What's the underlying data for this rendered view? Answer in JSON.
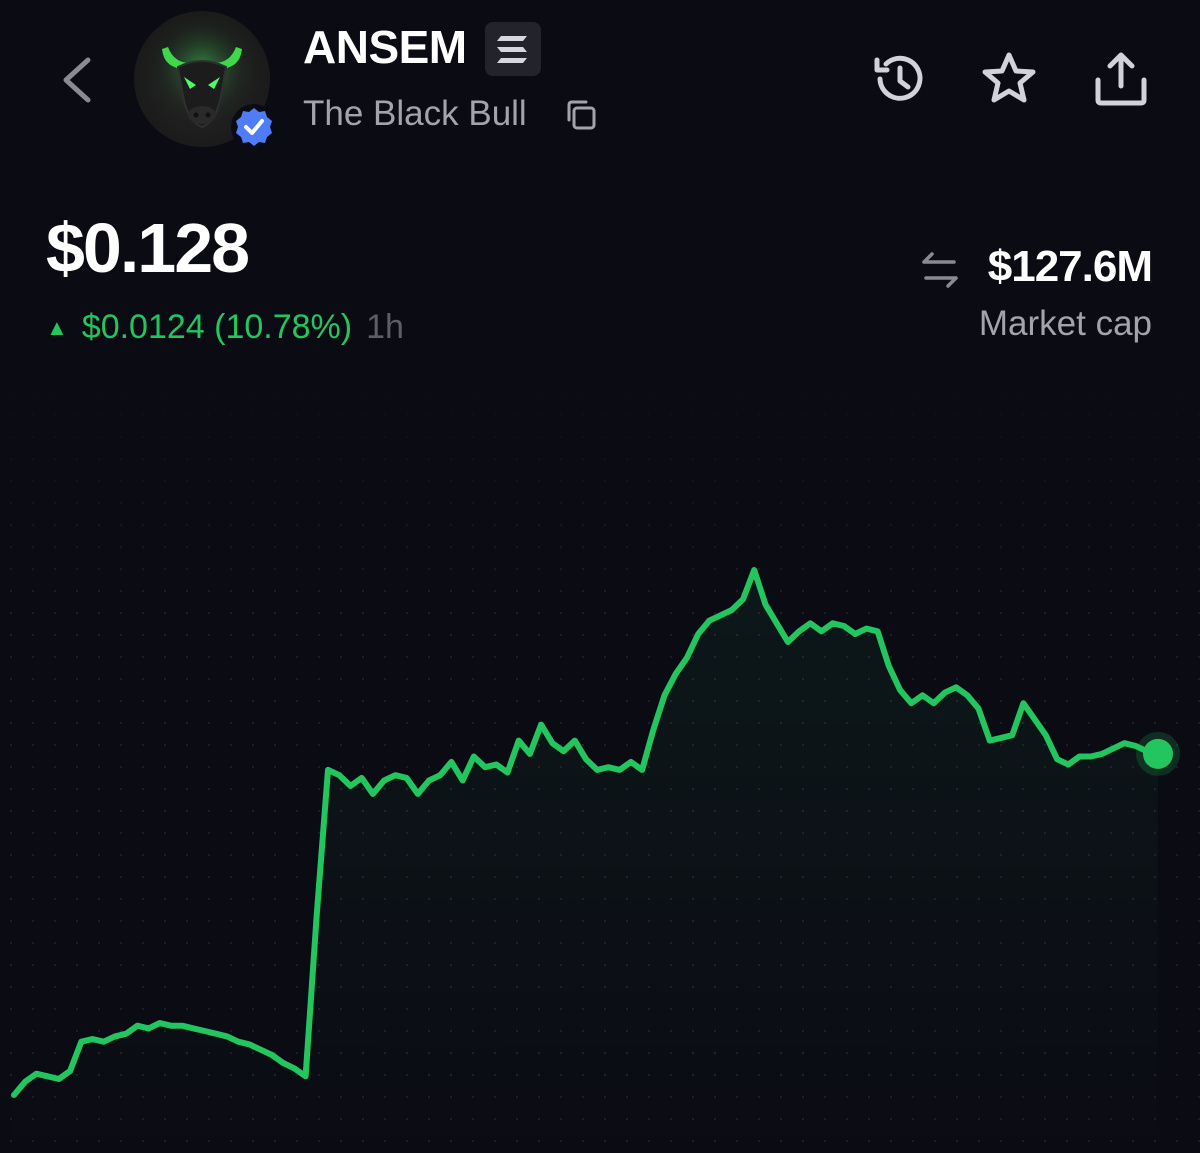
{
  "header": {
    "token_symbol": "ANSEM",
    "token_name": "The Black Bull",
    "chain_icon": "solana-icon",
    "icons": {
      "back": "chevron-left-icon",
      "verified": "verified-check-icon",
      "copy": "copy-icon",
      "history": "history-icon",
      "favorite": "star-icon",
      "share": "share-icon"
    }
  },
  "price": {
    "value": "$0.128",
    "change": "$0.0124 (10.78%)",
    "period": "1h",
    "direction": "up"
  },
  "market_cap": {
    "value": "$127.6M",
    "label": "Market cap"
  },
  "colors": {
    "background": "#0b0b14",
    "accent_green": "#22c55e",
    "muted_text": "#a3a3ad",
    "verified_blue": "#4f7cf7"
  },
  "chart_data": {
    "type": "line",
    "period": "1h",
    "grid": "dotted",
    "y_direction": "price",
    "values": [
      0.1,
      0.1005,
      0.1008,
      0.1007,
      0.1006,
      0.1009,
      0.102,
      0.1021,
      0.102,
      0.1022,
      0.1023,
      0.1026,
      0.1025,
      0.1027,
      0.1026,
      0.1026,
      0.1025,
      0.1024,
      0.1023,
      0.1022,
      0.102,
      0.1019,
      0.1017,
      0.1015,
      0.1012,
      0.101,
      0.1007,
      0.1068,
      0.1122,
      0.112,
      0.1116,
      0.1119,
      0.1113,
      0.1118,
      0.112,
      0.1119,
      0.1113,
      0.1118,
      0.112,
      0.1125,
      0.1118,
      0.1127,
      0.1123,
      0.1124,
      0.1121,
      0.1133,
      0.1128,
      0.1139,
      0.1132,
      0.1129,
      0.1133,
      0.1126,
      0.1122,
      0.1123,
      0.1122,
      0.1125,
      0.1122,
      0.1137,
      0.115,
      0.1158,
      0.1164,
      0.1173,
      0.1178,
      0.118,
      0.1182,
      0.1186,
      0.1197,
      0.1184,
      0.1177,
      0.117,
      0.1174,
      0.1177,
      0.1174,
      0.1177,
      0.1176,
      0.1173,
      0.1175,
      0.1174,
      0.1161,
      0.1152,
      0.1147,
      0.115,
      0.1147,
      0.1151,
      0.1153,
      0.115,
      0.1145,
      0.1133,
      0.1134,
      0.1135,
      0.1147,
      0.1141,
      0.1135,
      0.1126,
      0.1124,
      0.1127,
      0.1127,
      0.1128,
      0.113,
      0.1132,
      0.1131,
      0.1129,
      0.1128
    ]
  }
}
